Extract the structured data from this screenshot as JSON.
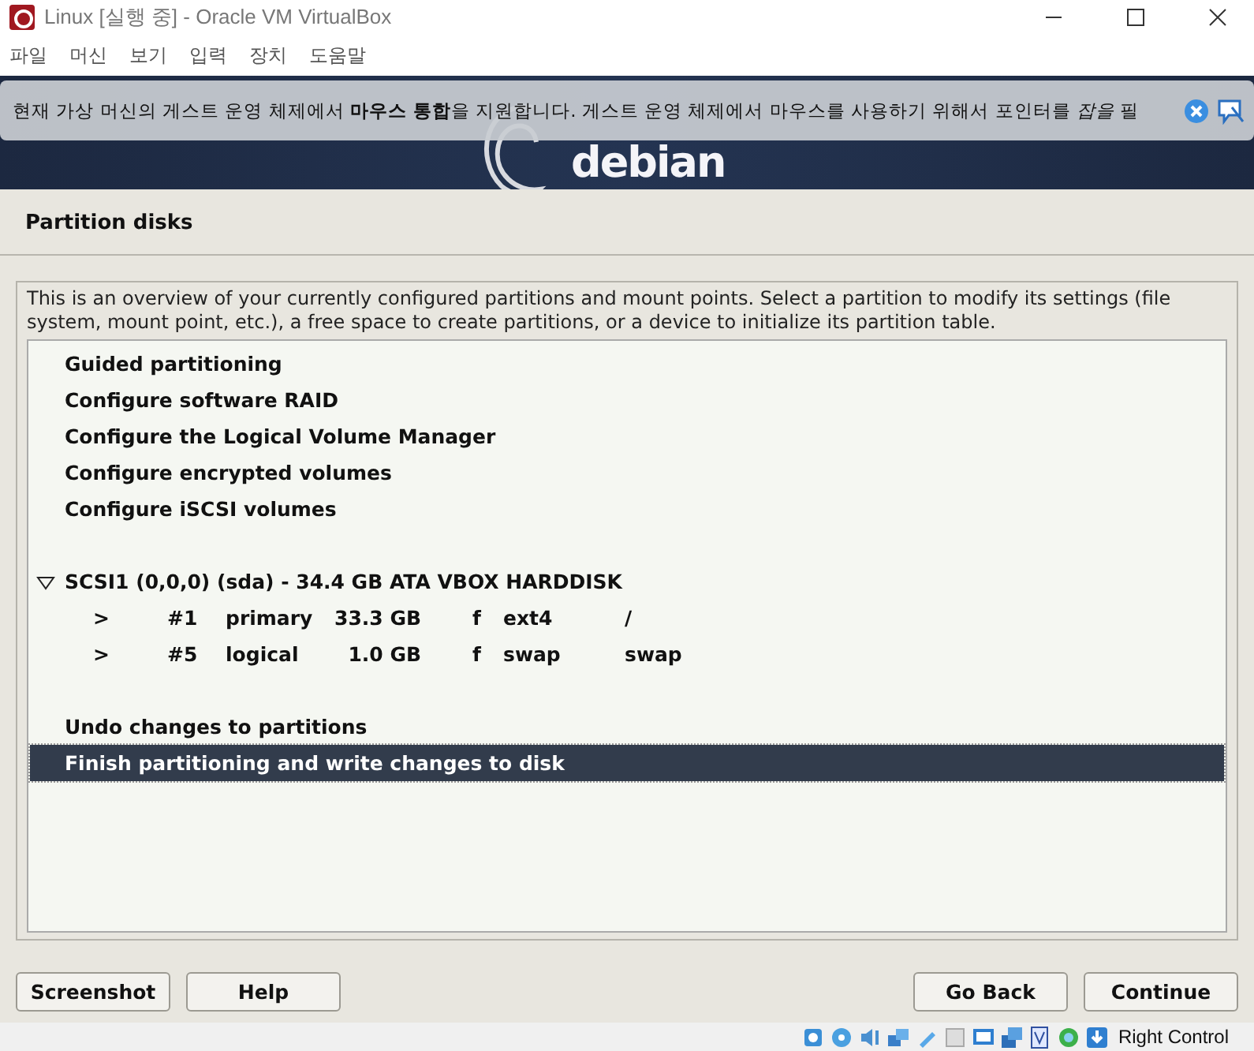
{
  "window": {
    "title": "Linux [실행 중] - Oracle VM VirtualBox"
  },
  "menu": [
    "파일",
    "머신",
    "보기",
    "입력",
    "장치",
    "도움말"
  ],
  "notification": {
    "text": "현재 가상 머신의 게스트 운영 체제에서 **마우스 통합**을 지원합니다. 게스트 운영 체제에서 마우스를 사용하기 위해서 포인터를 *잡을* 필"
  },
  "banner": {
    "logo": "debian"
  },
  "page_title": "Partition disks",
  "description": "This is an overview of your currently configured partitions and mount points. Select a partition to modify its settings (file system, mount point, etc.), a free space to create partitions, or a device to initialize its partition table.",
  "groups": [
    {
      "items": [
        {
          "kind": "action",
          "label": "Guided partitioning",
          "selected": false
        },
        {
          "kind": "action",
          "label": "Configure software RAID",
          "selected": false
        },
        {
          "kind": "action",
          "label": "Configure the Logical Volume Manager",
          "selected": false
        },
        {
          "kind": "action",
          "label": "Configure encrypted volumes",
          "selected": false
        },
        {
          "kind": "action",
          "label": "Configure iSCSI volumes",
          "selected": false
        }
      ]
    },
    {
      "items": [
        {
          "kind": "disk",
          "label": "SCSI1 (0,0,0) (sda) - 34.4 GB ATA VBOX HARDDISK",
          "expanded": true,
          "selected": false
        },
        {
          "kind": "partition",
          "arrow": ">",
          "number": "#1",
          "type": "primary",
          "size": "33.3 GB",
          "flag": "f",
          "fs": "ext4",
          "mount": "/",
          "selected": false
        },
        {
          "kind": "partition",
          "arrow": ">",
          "number": "#5",
          "type": "logical",
          "size": "1.0 GB",
          "flag": "f",
          "fs": "swap",
          "mount": "swap",
          "selected": false
        }
      ]
    },
    {
      "items": [
        {
          "kind": "action",
          "label": "Undo changes to partitions",
          "selected": false
        },
        {
          "kind": "action",
          "label": "Finish partitioning and write changes to disk",
          "selected": true
        }
      ]
    }
  ],
  "buttons_left": [
    "Screenshot",
    "Help"
  ],
  "buttons_right": [
    "Go Back",
    "Continue"
  ],
  "status_bar": {
    "key": "Right Control"
  }
}
